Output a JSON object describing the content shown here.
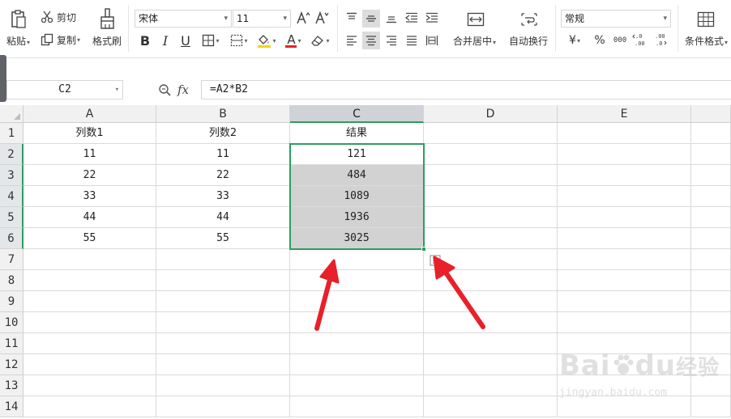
{
  "ribbon": {
    "paste_label": "粘贴",
    "cut_label": "剪切",
    "copy_label": "复制",
    "format_painter_label": "格式刷",
    "font_name": "宋体",
    "font_size": "11",
    "merge_center_label": "合并居中",
    "wrap_text_label": "自动换行",
    "number_format": "常规",
    "currency_symbol": "¥",
    "percent_symbol": "%",
    "thousands_symbol": "000",
    "conditional_format_label": "条件格式",
    "bold_glyph": "B",
    "italic_glyph": "I",
    "underline_glyph": "U",
    "font_color_glyph": "A"
  },
  "formula_bar": {
    "name_box": "C2",
    "fx_label": "fx",
    "formula": "=A2*B2"
  },
  "sheet": {
    "columns": [
      "A",
      "B",
      "C",
      "D",
      "E"
    ],
    "selected_column": "C",
    "rows": [
      "1",
      "2",
      "3",
      "4",
      "5",
      "6",
      "7",
      "8",
      "9",
      "10",
      "11",
      "12",
      "13",
      "14"
    ],
    "selected_rows": [
      "2",
      "3",
      "4",
      "5",
      "6"
    ],
    "cells": [
      [
        "列数1",
        "列数2",
        "结果",
        "",
        ""
      ],
      [
        "11",
        "11",
        "121",
        "",
        ""
      ],
      [
        "22",
        "22",
        "484",
        "",
        ""
      ],
      [
        "33",
        "33",
        "1089",
        "",
        ""
      ],
      [
        "44",
        "44",
        "1936",
        "",
        ""
      ],
      [
        "55",
        "55",
        "3025",
        "",
        ""
      ]
    ]
  },
  "colors": {
    "selection_border": "#2e9d5f",
    "selection_fill": "#d2d2d2",
    "arrow": "#e8202a"
  },
  "watermark": {
    "brand": "Bai",
    "brand_suffix": "du",
    "brand_cn": "经验",
    "url": "jingyan.baidu.com"
  }
}
